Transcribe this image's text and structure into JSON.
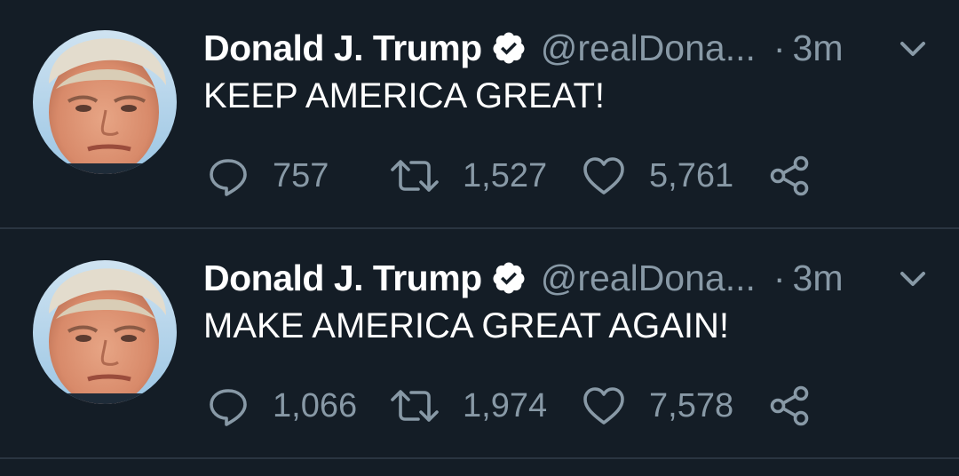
{
  "theme": {
    "background": "#141d26",
    "text": "#ffffff",
    "muted": "#8899a6",
    "divider": "#2a3541",
    "verified_badge": "#ffffff"
  },
  "tweets": [
    {
      "display_name": "Donald J. Trump",
      "handle": "@realDona...",
      "separator": "·",
      "time": "3m",
      "text": "KEEP AMERICA GREAT!",
      "replies": "757",
      "retweets": "1,527",
      "likes": "5,761",
      "icons": [
        "verified-icon",
        "chevron-down-icon",
        "reply-icon",
        "retweet-icon",
        "like-icon",
        "share-icon"
      ]
    },
    {
      "display_name": "Donald J. Trump",
      "handle": "@realDona...",
      "separator": "·",
      "time": "3m",
      "text": "MAKE AMERICA GREAT AGAIN!",
      "replies": "1,066",
      "retweets": "1,974",
      "likes": "7,578",
      "icons": [
        "verified-icon",
        "chevron-down-icon",
        "reply-icon",
        "retweet-icon",
        "like-icon",
        "share-icon"
      ]
    }
  ]
}
